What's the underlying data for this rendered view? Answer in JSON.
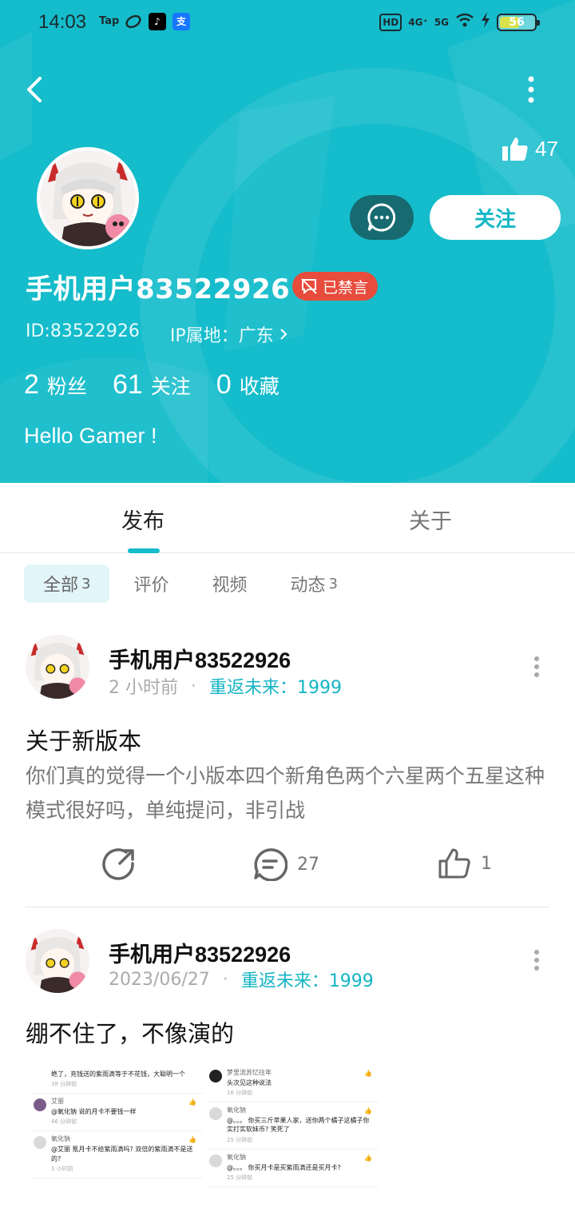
{
  "status_bar": {
    "time": "14:03",
    "left_icons": [
      "tap-icon",
      "leaf-icon",
      "tiktok-icon",
      "alipay-icon"
    ],
    "tap_label": "Tap",
    "net1": "4G⁺",
    "net2": "5G",
    "hd": "HD",
    "battery": "56",
    "battery_level": 0.56
  },
  "header": {
    "likes": "47",
    "follow_label": "关注",
    "username": "手机用户83522926",
    "muted_badge": "已禁言",
    "id_text": "ID:83522926",
    "ip_text": "IP属地：广东",
    "stats": [
      {
        "num": "2",
        "label": "粉丝"
      },
      {
        "num": "61",
        "label": "关注"
      },
      {
        "num": "0",
        "label": "收藏"
      }
    ],
    "bio": "Hello Gamer !"
  },
  "tabs": {
    "posts": "发布",
    "about": "关于"
  },
  "filters": [
    {
      "label": "全部",
      "count": "3"
    },
    {
      "label": "评价",
      "count": ""
    },
    {
      "label": "视频",
      "count": ""
    },
    {
      "label": "动态",
      "count": "3"
    }
  ],
  "posts": [
    {
      "author": "手机用户83522926",
      "time": "2 小时前",
      "game": "重返未来：1999",
      "title": "关于新版本",
      "body": "你们真的觉得一个小版本四个新角色两个六星两个五星这种模式很好吗，单纯提问，非引战",
      "comments": "27",
      "likes": "1"
    },
    {
      "author": "手机用户83522926",
      "time": "2023/06/27",
      "game": "重返未来：1999",
      "title": "绷不住了，不像演的"
    }
  ],
  "screenshot_left": [
    {
      "name": "",
      "text": "绝了，充钱送的紫雨滴等于不花钱，大聪明一个",
      "time": "38 分钟前"
    },
    {
      "name": "艾丽",
      "text": "@氧化钠  说的月卡不要钱一样",
      "time": "46 分钟前"
    },
    {
      "name": "氧化钠",
      "text": "@艾丽  氪月卡不给紫雨滴吗? 双倍的紫雨滴不是送的?",
      "time": "1 小时前"
    }
  ],
  "screenshot_right": [
    {
      "name": "梦里流苏忆往年",
      "text": "头次见这种说法",
      "time": "16 分钟前"
    },
    {
      "name": "氧化钠",
      "text": "@。。。 你买三斤苹果人家，送你两个橘子这橘子你实打实软妹币? 笑死了",
      "time": "25 分钟前"
    },
    {
      "name": "氧化钠",
      "text": "@。。。 你买月卡是买紫雨滴还是买月卡?",
      "time": "25 分钟前"
    }
  ]
}
